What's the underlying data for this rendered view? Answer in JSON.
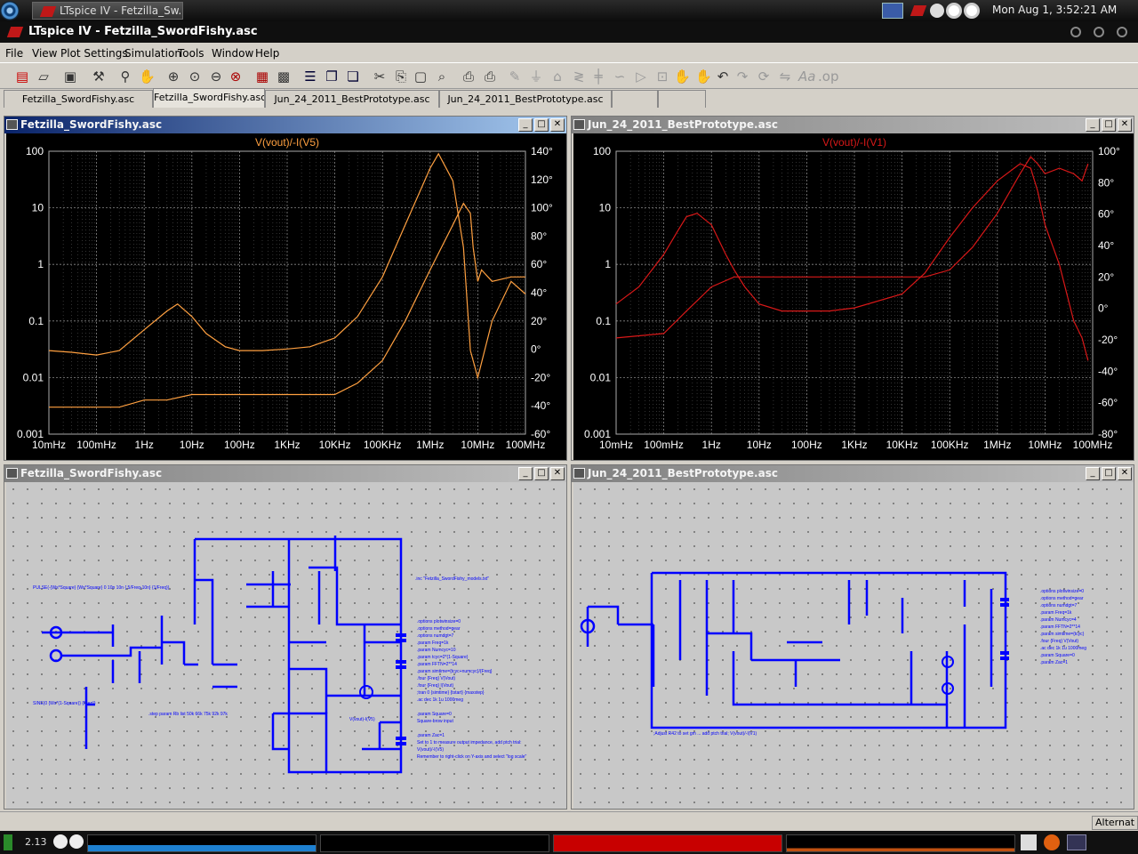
{
  "topbar": {
    "task_label": "LTspice IV - Fetzilla_Sw...",
    "clock": "Mon Aug  1,  3:52:21 AM"
  },
  "window": {
    "title": "LTspice IV - Fetzilla_SwordFishy.asc"
  },
  "menu": [
    "File",
    "View",
    "Plot Settings",
    "Simulation",
    "Tools",
    "Window",
    "Help"
  ],
  "tabs": [
    "Fetzilla_SwordFishy.asc",
    "Fetzilla_SwordFishy.asc",
    "Jun_24_2011_BestPrototype.asc",
    "Jun_24_2011_BestPrototype.asc",
    "",
    ""
  ],
  "panes": {
    "plot_left_title": "Fetzilla_SwordFishy.asc",
    "plot_right_title": "Jun_24_2011_BestPrototype.asc",
    "sch_left_title": "Fetzilla_SwordFishy.asc",
    "sch_right_title": "Jun_24_2011_BestPrototype.asc"
  },
  "status": {
    "text": "Alternat"
  },
  "bottombar": {
    "load": "2.13"
  },
  "colors": {
    "orange": "#ffa040",
    "red": "#d81818",
    "wire": "#0000ff",
    "bg": "#000000"
  },
  "chart_data": [
    {
      "type": "line",
      "title": "V(vout)/-I(V5)",
      "x_ticks": [
        "10mHz",
        "100mHz",
        "1Hz",
        "10Hz",
        "100Hz",
        "1KHz",
        "10KHz",
        "100KHz",
        "1MHz",
        "10MHz",
        "100MHz"
      ],
      "y_ticks_left": [
        "100",
        "10",
        "1",
        "0.1",
        "0.01",
        "0.001"
      ],
      "y_ticks_right": [
        "140°",
        "120°",
        "100°",
        "80°",
        "60°",
        "40°",
        "20°",
        "0°",
        "-20°",
        "-40°",
        "-60°"
      ],
      "x_scale": "log",
      "y_scale": "log",
      "ylim": [
        0.001,
        100
      ],
      "y2lim": [
        -60,
        140
      ],
      "color": "#ffa040",
      "series": [
        {
          "x": [
            0.01,
            0.03,
            0.1,
            0.3,
            1,
            3,
            5,
            10,
            20,
            50,
            100,
            300,
            1000,
            3000,
            10000,
            30000,
            100000,
            300000,
            1000000,
            1500000,
            3000000,
            5000000,
            7000000,
            10000000,
            20000000,
            50000000,
            100000000
          ],
          "y": [
            0.03,
            0.028,
            0.025,
            0.03,
            0.07,
            0.15,
            0.2,
            0.12,
            0.06,
            0.035,
            0.03,
            0.03,
            0.032,
            0.035,
            0.05,
            0.12,
            0.6,
            5,
            50,
            90,
            30,
            2,
            0.03,
            0.01,
            0.1,
            0.5,
            0.3
          ]
        },
        {
          "x": [
            0.01,
            0.1,
            0.3,
            1,
            3,
            10,
            100,
            1000,
            10000,
            30000,
            100000,
            300000,
            1000000,
            3000000,
            5000000,
            7000000,
            8000000,
            10000000,
            12000000,
            20000000,
            50000000,
            100000000
          ],
          "y": [
            0.003,
            0.003,
            0.003,
            0.004,
            0.004,
            0.005,
            0.005,
            0.005,
            0.005,
            0.008,
            0.02,
            0.1,
            0.8,
            5,
            12,
            8,
            2,
            0.5,
            0.8,
            0.5,
            0.6,
            0.6
          ]
        }
      ]
    },
    {
      "type": "line",
      "title": "V(vout)/-I(V1)",
      "x_ticks": [
        "10mHz",
        "100mHz",
        "1Hz",
        "10Hz",
        "100Hz",
        "1KHz",
        "10KHz",
        "100KHz",
        "1MHz",
        "10MHz",
        "100MHz"
      ],
      "y_ticks_left": [
        "100",
        "10",
        "1",
        "0.1",
        "0.01",
        "0.001"
      ],
      "y_ticks_right": [
        "100°",
        "80°",
        "60°",
        "40°",
        "20°",
        "0°",
        "-20°",
        "-40°",
        "-60°",
        "-80°"
      ],
      "x_scale": "log",
      "y_scale": "log",
      "ylim": [
        0.001,
        100
      ],
      "y2lim": [
        -80,
        100
      ],
      "color": "#d81818",
      "series": [
        {
          "x": [
            0.01,
            0.03,
            0.1,
            0.2,
            0.3,
            0.5,
            1,
            2,
            3,
            5,
            10,
            30,
            100,
            300,
            1000,
            10000,
            30000,
            100000,
            300000,
            1000000,
            3000000,
            5000000,
            7000000,
            10000000,
            20000000,
            40000000,
            60000000,
            80000000
          ],
          "y": [
            0.2,
            0.4,
            1.5,
            4,
            7,
            8,
            5,
            1.5,
            0.8,
            0.4,
            0.2,
            0.15,
            0.15,
            0.15,
            0.17,
            0.3,
            0.7,
            3,
            10,
            30,
            60,
            50,
            20,
            5,
            1,
            0.1,
            0.05,
            0.02
          ]
        },
        {
          "x": [
            0.01,
            0.1,
            0.3,
            1,
            3,
            10,
            100,
            1000,
            10000,
            30000,
            100000,
            300000,
            1000000,
            3000000,
            5000000,
            7000000,
            10000000,
            20000000,
            40000000,
            60000000,
            80000000
          ],
          "y": [
            0.05,
            0.06,
            0.15,
            0.4,
            0.6,
            0.6,
            0.6,
            0.6,
            0.6,
            0.6,
            0.8,
            2,
            8,
            40,
            80,
            60,
            40,
            50,
            40,
            30,
            60
          ]
        }
      ]
    }
  ]
}
